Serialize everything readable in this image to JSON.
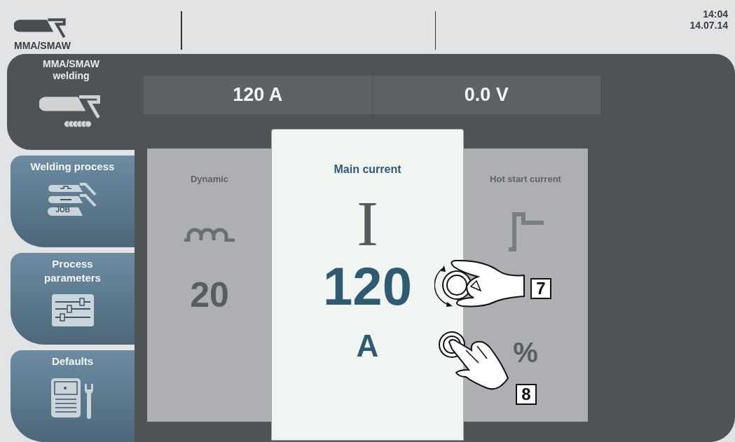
{
  "top_bar": {
    "mode_label": "MMA/SMAW",
    "time": "14:04",
    "date": "14.07.14"
  },
  "process": {
    "title": "MMA/SMAW welding"
  },
  "readouts": [
    {
      "value": "120 A"
    },
    {
      "value": "0.0 V"
    }
  ],
  "nav": [
    {
      "label": "Welding process",
      "kind": "process",
      "icon_text": "JOB"
    },
    {
      "label": "Process parameters",
      "kind": "parameters"
    },
    {
      "label": "Defaults",
      "kind": "defaults"
    }
  ],
  "parameters": [
    {
      "label": "Dynamic",
      "kind": "dynamic",
      "value": "20",
      "selected": false
    },
    {
      "label": "Main current",
      "kind": "current",
      "symbol": "I",
      "value": "120",
      "unit": "A",
      "selected": true
    },
    {
      "label": "Hot start current",
      "kind": "hotstart",
      "unit": "%",
      "selected": false
    }
  ],
  "callouts": [
    {
      "number": "7"
    },
    {
      "number": "8"
    }
  ]
}
